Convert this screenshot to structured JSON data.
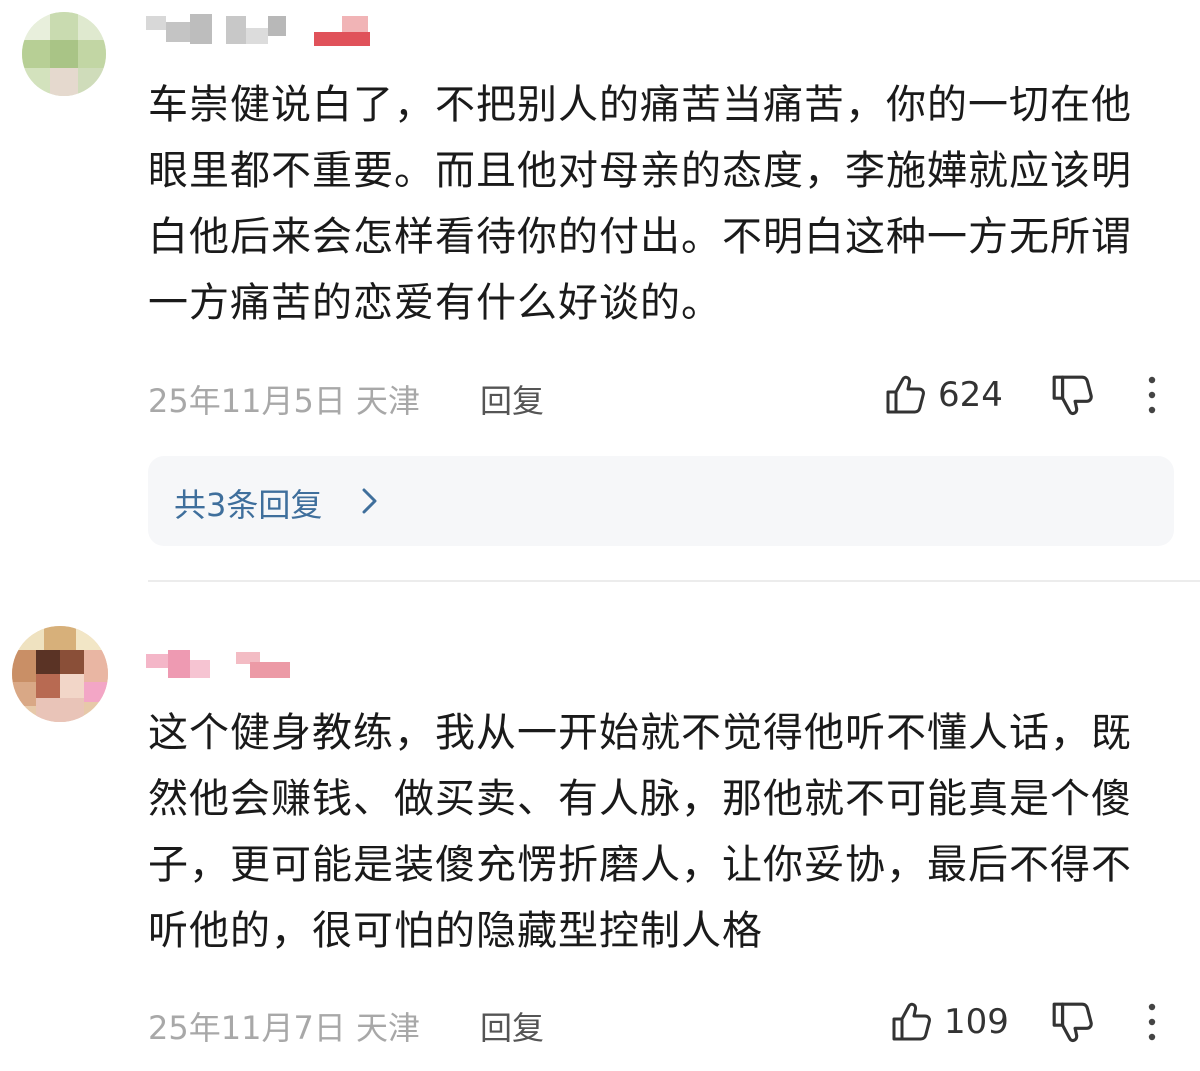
{
  "comments": [
    {
      "avatar_icon": "blurred-avatar-icon",
      "username_icon": "blurred-username",
      "text": "车崇健说白了，不把别人的痛苦当痛苦，你的一切在他眼里都不重要。而且他对母亲的态度，李施嬅就应该明白他后来会怎样看待你的付出。不明白这种一方无所谓一方痛苦的恋爱有什么好谈的。",
      "date_location": "25年11月5日 天津",
      "reply_label": "回复",
      "likes": "624",
      "replies_summary": "共3条回复"
    },
    {
      "avatar_icon": "blurred-avatar-icon",
      "username_icon": "blurred-username",
      "text": "这个健身教练，我从一开始就不觉得他听不懂人话，既然他会赚钱、做买卖、有人脉，那他就不可能真是个傻子，更可能是装傻充愣折磨人，让你妥协，最后不得不听他的，很可怕的隐藏型控制人格",
      "date_location": "25年11月7日 天津",
      "reply_label": "回复",
      "likes": "109"
    }
  ],
  "icons": {
    "like": "thumbs-up-icon",
    "dislike": "thumbs-down-icon",
    "more": "more-vertical-icon",
    "expand": "chevron-right-icon"
  },
  "colors": {
    "text": "#1a1a1a",
    "meta": "#a8a8a8",
    "link": "#3f6f9c",
    "reply_box_bg": "#f6f7f9",
    "divider": "#ececec"
  }
}
